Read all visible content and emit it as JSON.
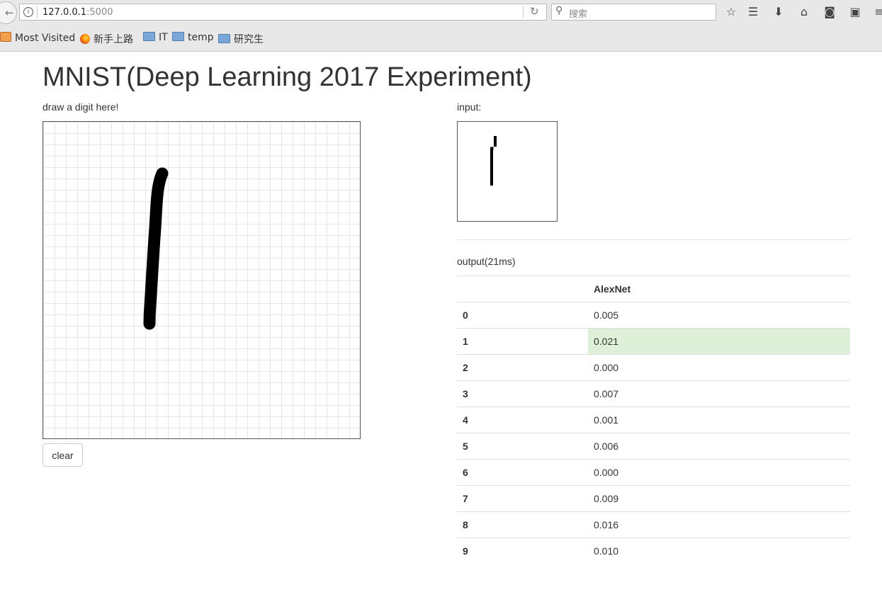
{
  "browser": {
    "url_host": "127.0.0.1",
    "url_port": ":5000",
    "search_placeholder": "搜索",
    "bookmarks": [
      "Most Visited",
      "新手上路",
      "IT",
      "temp",
      "研究生"
    ]
  },
  "page": {
    "title": "MNIST(Deep Learning 2017 Experiment)",
    "draw_label": "draw a digit here!",
    "clear_label": "clear",
    "input_label": "input:",
    "output_label": "output(21ms)"
  },
  "results": {
    "model": "AlexNet",
    "rows": [
      {
        "digit": "0",
        "value": "0.005"
      },
      {
        "digit": "1",
        "value": "0.021"
      },
      {
        "digit": "2",
        "value": "0.000"
      },
      {
        "digit": "3",
        "value": "0.007"
      },
      {
        "digit": "4",
        "value": "0.001"
      },
      {
        "digit": "5",
        "value": "0.006"
      },
      {
        "digit": "6",
        "value": "0.000"
      },
      {
        "digit": "7",
        "value": "0.009"
      },
      {
        "digit": "8",
        "value": "0.016"
      },
      {
        "digit": "9",
        "value": "0.010"
      }
    ],
    "highlight_color": "#dff0d8"
  },
  "icons": [
    "back-icon",
    "info-icon",
    "reload-icon",
    "search-icon",
    "bookmark-star-icon",
    "reading-list-icon",
    "download-icon",
    "home-icon",
    "pocket-icon",
    "reader-view-icon",
    "menu-icon"
  ]
}
